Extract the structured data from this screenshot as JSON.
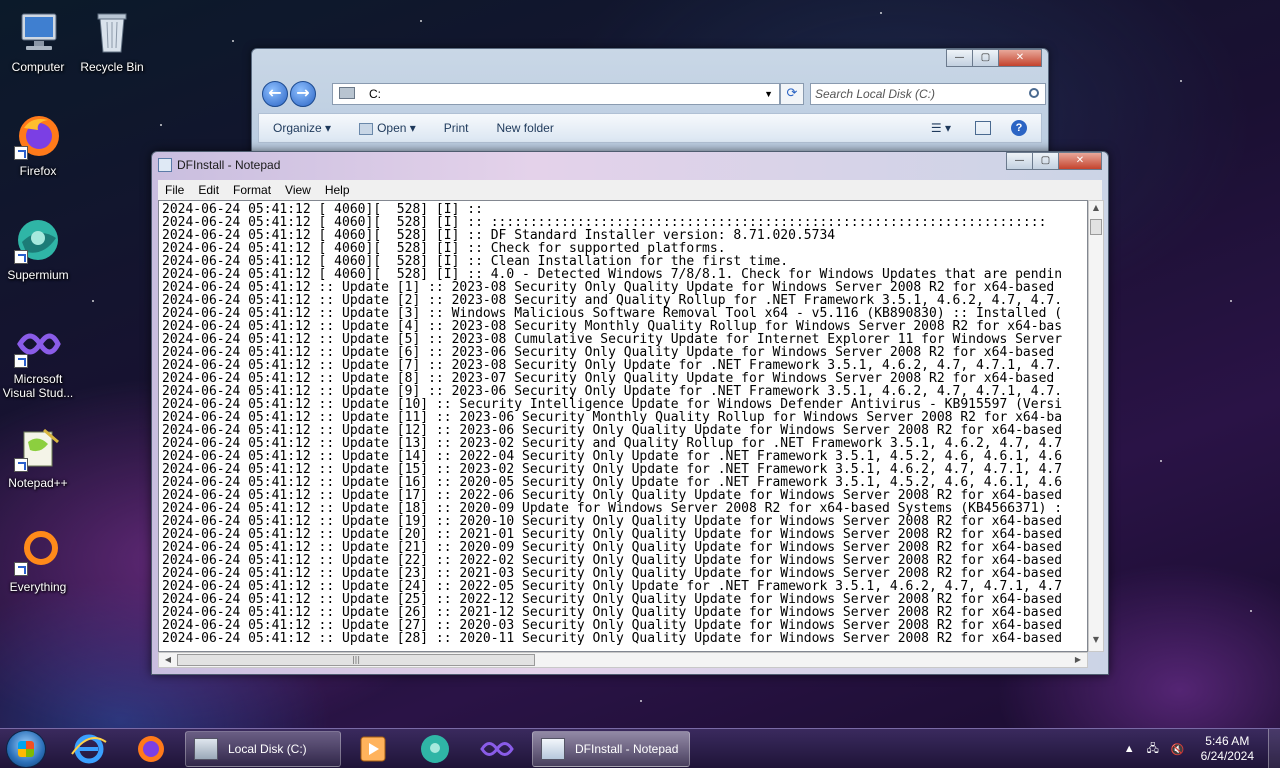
{
  "desktop": {
    "icons": [
      {
        "label": "Computer"
      },
      {
        "label": "Recycle Bin"
      },
      {
        "label": "Firefox"
      },
      {
        "label": "Supermium"
      },
      {
        "label": "Microsoft Visual Stud..."
      },
      {
        "label": "Notepad++"
      },
      {
        "label": "Everything"
      }
    ]
  },
  "explorer": {
    "address_path": "C:",
    "search_placeholder": "Search Local Disk (C:)",
    "toolbar": {
      "organize": "Organize",
      "open": "Open",
      "print": "Print",
      "new_folder": "New folder"
    }
  },
  "notepad": {
    "title": "DFInstall - Notepad",
    "menu": [
      "File",
      "Edit",
      "Format",
      "View",
      "Help"
    ],
    "lines": [
      "2024-06-24 05:41:12 [ 4060][  528] [I] ::",
      "2024-06-24 05:41:12 [ 4060][  528] [I] :: :::::::::::::::::::::::::::::::::::::::::::::::::::::::::::::::::::::::",
      "2024-06-24 05:41:12 [ 4060][  528] [I] :: DF Standard Installer version: 8.71.020.5734",
      "2024-06-24 05:41:12 [ 4060][  528] [I] :: Check for supported platforms.",
      "2024-06-24 05:41:12 [ 4060][  528] [I] :: Clean Installation for the first time.",
      "2024-06-24 05:41:12 [ 4060][  528] [I] :: 4.0 - Detected Windows 7/8/8.1. Check for Windows Updates that are pendin",
      "2024-06-24 05:41:12 :: Update [1] :: 2023-08 Security Only Quality Update for Windows Server 2008 R2 for x64-based",
      "2024-06-24 05:41:12 :: Update [2] :: 2023-08 Security and Quality Rollup for .NET Framework 3.5.1, 4.6.2, 4.7, 4.7.",
      "2024-06-24 05:41:12 :: Update [3] :: Windows Malicious Software Removal Tool x64 - v5.116 (KB890830) :: Installed (",
      "2024-06-24 05:41:12 :: Update [4] :: 2023-08 Security Monthly Quality Rollup for Windows Server 2008 R2 for x64-bas",
      "2024-06-24 05:41:12 :: Update [5] :: 2023-08 Cumulative Security Update for Internet Explorer 11 for Windows Server",
      "2024-06-24 05:41:12 :: Update [6] :: 2023-06 Security Only Quality Update for Windows Server 2008 R2 for x64-based",
      "2024-06-24 05:41:12 :: Update [7] :: 2023-08 Security Only Update for .NET Framework 3.5.1, 4.6.2, 4.7, 4.7.1, 4.7.",
      "2024-06-24 05:41:12 :: Update [8] :: 2023-07 Security Only Quality Update for Windows Server 2008 R2 for x64-based",
      "2024-06-24 05:41:12 :: Update [9] :: 2023-06 Security Only Update for .NET Framework 3.5.1, 4.6.2, 4.7, 4.7.1, 4.7.",
      "2024-06-24 05:41:12 :: Update [10] :: Security Intelligence Update for Windows Defender Antivirus - KB915597 (Versi",
      "2024-06-24 05:41:12 :: Update [11] :: 2023-06 Security Monthly Quality Rollup for Windows Server 2008 R2 for x64-ba",
      "2024-06-24 05:41:12 :: Update [12] :: 2023-06 Security Only Quality Update for Windows Server 2008 R2 for x64-based",
      "2024-06-24 05:41:12 :: Update [13] :: 2023-02 Security and Quality Rollup for .NET Framework 3.5.1, 4.6.2, 4.7, 4.7",
      "2024-06-24 05:41:12 :: Update [14] :: 2022-04 Security Only Update for .NET Framework 3.5.1, 4.5.2, 4.6, 4.6.1, 4.6",
      "2024-06-24 05:41:12 :: Update [15] :: 2023-02 Security Only Update for .NET Framework 3.5.1, 4.6.2, 4.7, 4.7.1, 4.7",
      "2024-06-24 05:41:12 :: Update [16] :: 2020-05 Security Only Update for .NET Framework 3.5.1, 4.5.2, 4.6, 4.6.1, 4.6",
      "2024-06-24 05:41:12 :: Update [17] :: 2022-06 Security Only Quality Update for Windows Server 2008 R2 for x64-based",
      "2024-06-24 05:41:12 :: Update [18] :: 2020-09 Update for Windows Server 2008 R2 for x64-based Systems (KB4566371) :",
      "2024-06-24 05:41:12 :: Update [19] :: 2020-10 Security Only Quality Update for Windows Server 2008 R2 for x64-based",
      "2024-06-24 05:41:12 :: Update [20] :: 2021-01 Security Only Quality Update for Windows Server 2008 R2 for x64-based",
      "2024-06-24 05:41:12 :: Update [21] :: 2020-09 Security Only Quality Update for Windows Server 2008 R2 for x64-based",
      "2024-06-24 05:41:12 :: Update [22] :: 2022-02 Security Only Quality Update for Windows Server 2008 R2 for x64-based",
      "2024-06-24 05:41:12 :: Update [23] :: 2021-03 Security Only Quality Update for Windows Server 2008 R2 for x64-based",
      "2024-06-24 05:41:12 :: Update [24] :: 2022-05 Security Only Update for .NET Framework 3.5.1, 4.6.2, 4.7, 4.7.1, 4.7",
      "2024-06-24 05:41:12 :: Update [25] :: 2022-12 Security Only Quality Update for Windows Server 2008 R2 for x64-based",
      "2024-06-24 05:41:12 :: Update [26] :: 2021-12 Security Only Quality Update for Windows Server 2008 R2 for x64-based",
      "2024-06-24 05:41:12 :: Update [27] :: 2020-03 Security Only Quality Update for Windows Server 2008 R2 for x64-based",
      "2024-06-24 05:41:12 :: Update [28] :: 2020-11 Security Only Quality Update for Windows Server 2008 R2 for x64-based"
    ]
  },
  "taskbar": {
    "tasks": [
      {
        "label": "Local Disk (C:)"
      },
      {
        "label": "DFInstall - Notepad"
      }
    ],
    "clock": {
      "time": "5:46 AM",
      "date": "6/24/2024"
    }
  }
}
